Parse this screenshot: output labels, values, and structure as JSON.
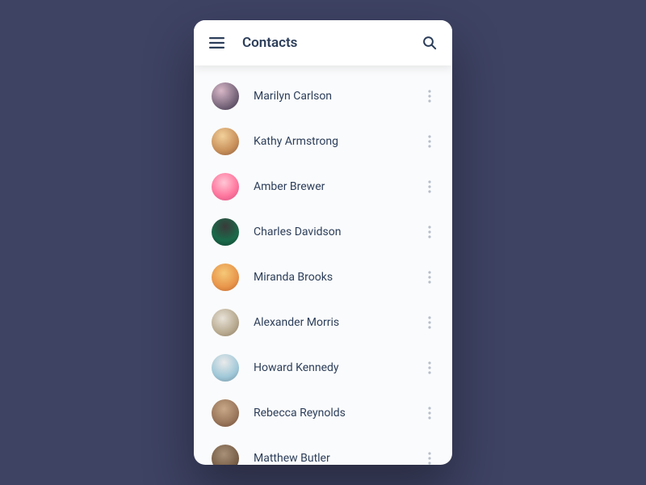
{
  "header": {
    "title": "Contacts"
  },
  "contacts": [
    {
      "name": "Marilyn Carlson"
    },
    {
      "name": "Kathy Armstrong"
    },
    {
      "name": "Amber Brewer"
    },
    {
      "name": "Charles Davidson"
    },
    {
      "name": "Miranda Brooks"
    },
    {
      "name": "Alexander Morris"
    },
    {
      "name": "Howard Kennedy"
    },
    {
      "name": "Rebecca Reynolds"
    },
    {
      "name": "Matthew Butler"
    }
  ]
}
